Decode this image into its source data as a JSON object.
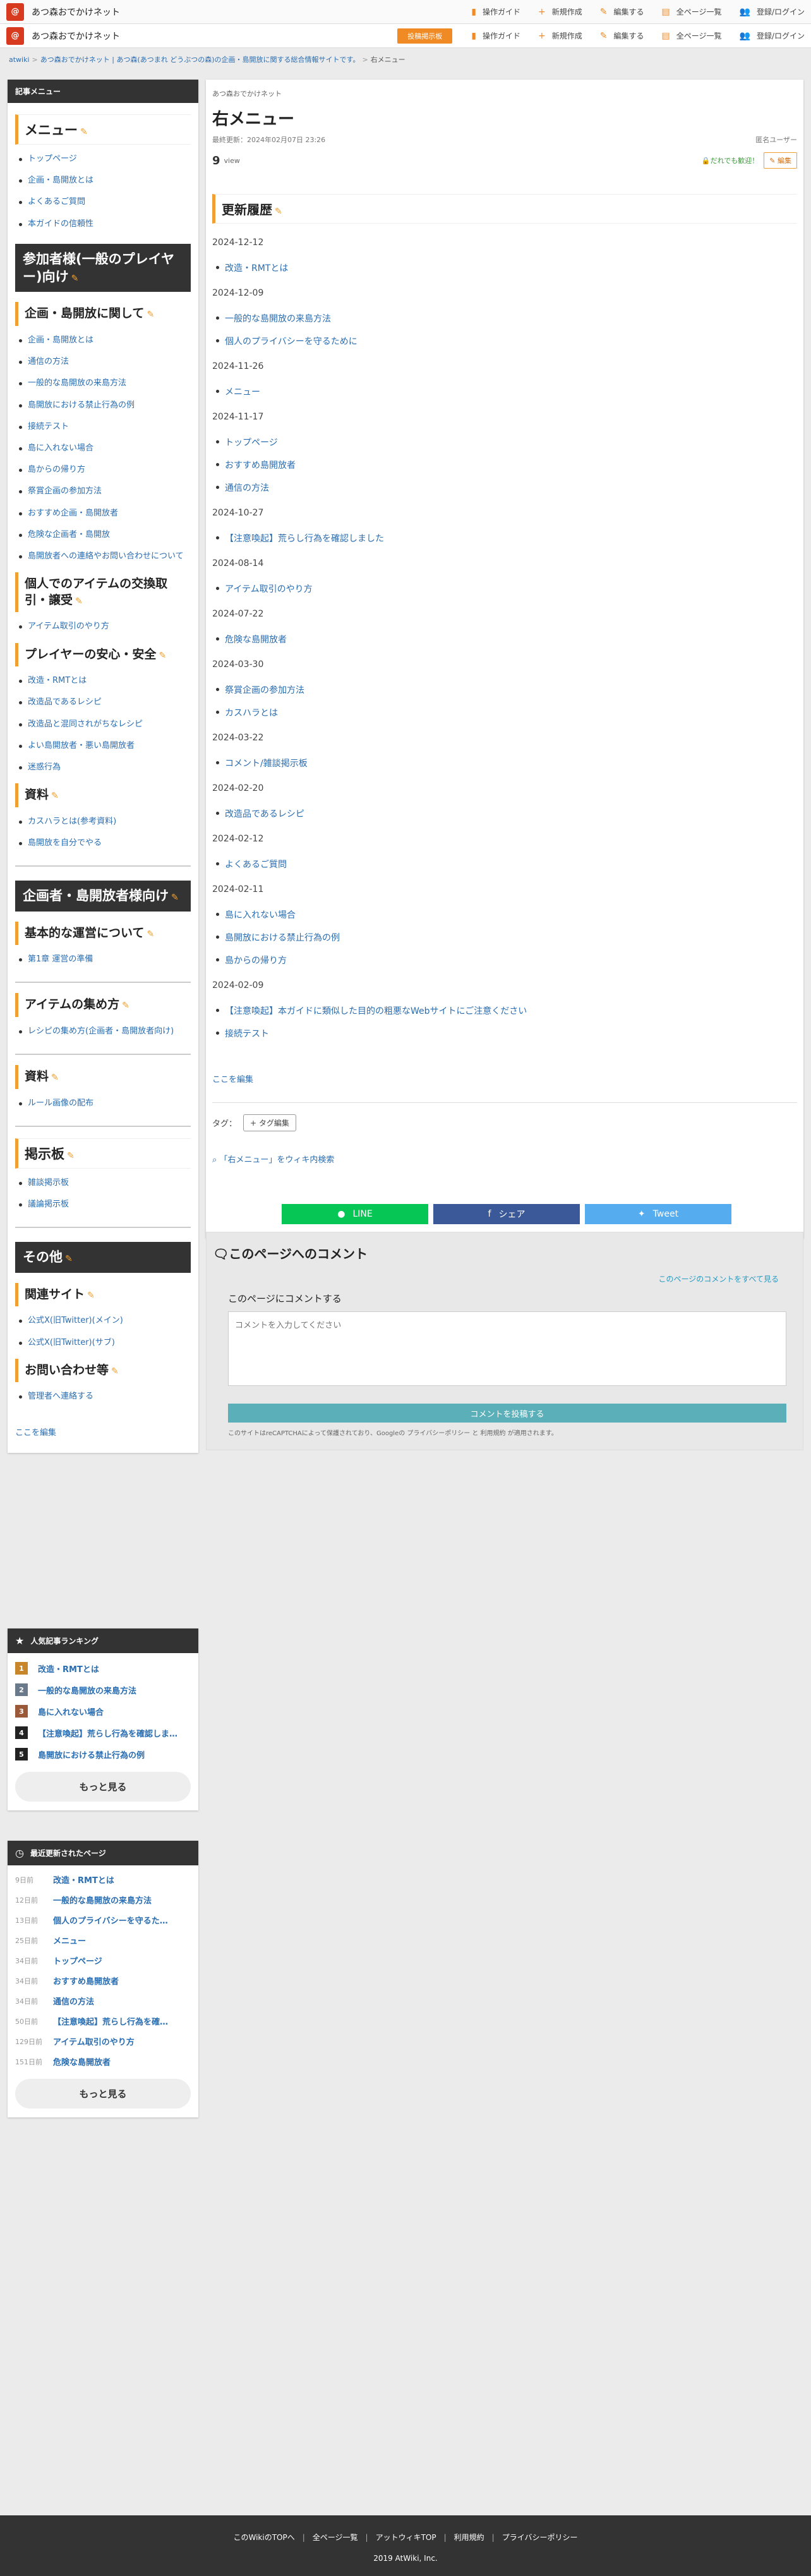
{
  "header": {
    "logo": "@",
    "site": "あつ森おでかけネット",
    "post_label": "投稿掲示板",
    "nav": [
      {
        "icon": "▮",
        "label": "操作ガイド"
      },
      {
        "icon": "+",
        "label": "新規作成"
      },
      {
        "icon": "✎",
        "label": "編集する"
      },
      {
        "icon": "▤",
        "label": "全ページ一覧"
      },
      {
        "icon": "👥",
        "label": "登録/ログイン"
      }
    ]
  },
  "breadcrumb": [
    "atwiki",
    "あつ森おでかけネット | あつ森(あつまれ どうぶつの森)の企画・島開放に関する総合情報サイトです。",
    "右メニュー"
  ],
  "sidebar": {
    "menu_header": "記事メニュー",
    "sections": [
      {
        "style": "h2o",
        "title": "メニュー",
        "items": [
          "トップページ",
          "企画・島開放とは",
          "よくあるご質問",
          "本ガイドの信頼性"
        ]
      },
      {
        "style": "h2d",
        "title": "参加者様(一般のプレイヤー)向け",
        "items": []
      },
      {
        "style": "h3o",
        "title": "企画・島開放に関して",
        "items": [
          "企画・島開放とは",
          "通信の方法",
          "一般的な島開放の来島方法",
          "島開放における禁止行為の例",
          "接続テスト",
          "島に入れない場合",
          "島からの帰り方",
          "祭賞企画の参加方法",
          "おすすめ企画・島開放者",
          "危険な企画者・島開放",
          "島開放者への連絡やお問い合わせについて"
        ]
      },
      {
        "style": "h3o",
        "title": "個人でのアイテムの交換取引・譲受",
        "items": [
          "アイテム取引のやり方"
        ]
      },
      {
        "style": "h3o",
        "title": "プレイヤーの安心・安全",
        "items": [
          "改造・RMTとは",
          "改造品であるレシピ",
          "改造品と混同されがちなレシピ",
          "よい島開放者・悪い島開放者",
          "迷惑行為"
        ]
      },
      {
        "style": "h3o",
        "title": "資料",
        "items": [
          "カスハラとは(参考資料)",
          "島開放を自分でやる"
        ]
      },
      {
        "style": "h2d",
        "title": "企画者・島開放者様向け",
        "items": [],
        "hr": true
      },
      {
        "style": "h3o",
        "title": "基本的な運営について",
        "items": [
          "第1章 運営の準備"
        ]
      },
      {
        "style": "h3o",
        "title": "アイテムの集め方",
        "items": [
          "レシピの集め方(企画者・島開放者向け)"
        ],
        "hr": true
      },
      {
        "style": "h3o",
        "title": "資料",
        "items": [
          "ルール画像の配布"
        ],
        "hr": true
      },
      {
        "style": "h2o",
        "title": "掲示板",
        "items": [
          "雑談掲示板",
          "議論掲示板"
        ],
        "hr": true
      },
      {
        "style": "h2d",
        "title": "その他",
        "items": [],
        "hr": true
      },
      {
        "style": "h3o",
        "title": "関連サイト",
        "items": [
          "公式X(旧Twitter)(メイン)",
          "公式X(旧Twitter)(サブ)"
        ]
      },
      {
        "style": "h3o",
        "title": "お問い合わせ等",
        "items": [
          "管理者へ連絡する"
        ]
      }
    ],
    "edit_link": "ここを編集",
    "ranking": {
      "title": "人気記事ランキング",
      "items": [
        {
          "n": "1",
          "t": "改造・RMTとは",
          "c": "#c8862a"
        },
        {
          "n": "2",
          "t": "一般的な島開放の来島方法",
          "c": "#6a7a8a"
        },
        {
          "n": "3",
          "t": "島に入れない場合",
          "c": "#9a5a3a"
        },
        {
          "n": "4",
          "t": "【注意喚起】荒らし行為を確認しま…",
          "c": "#222"
        },
        {
          "n": "5",
          "t": "島開放における禁止行為の例",
          "c": "#222"
        }
      ],
      "more": "もっと見る"
    },
    "recent": {
      "title": "最近更新されたページ",
      "items": [
        {
          "a": "9日前",
          "t": "改造・RMTとは"
        },
        {
          "a": "12日前",
          "t": "一般的な島開放の来島方法"
        },
        {
          "a": "13日前",
          "t": "個人のプライバシーを守るた…"
        },
        {
          "a": "25日前",
          "t": "メニュー"
        },
        {
          "a": "34日前",
          "t": "トップページ"
        },
        {
          "a": "34日前",
          "t": "おすすめ島開放者"
        },
        {
          "a": "34日前",
          "t": "通信の方法"
        },
        {
          "a": "50日前",
          "t": "【注意喚起】荒らし行為を確…"
        },
        {
          "a": "129日前",
          "t": "アイテム取引のやり方"
        },
        {
          "a": "151日前",
          "t": "危険な島開放者"
        }
      ],
      "more": "もっと見る"
    }
  },
  "main": {
    "site_small": "あつ森おでかけネット",
    "title": "右メニュー",
    "updated": "最終更新：2024年02月07日 23:26",
    "author": "匿名ユーザー",
    "views": "9",
    "views_unit": "view",
    "alert": "🔒だれでも歓迎！",
    "edit_btn": "✎ 編集",
    "section_title": "更新履歴",
    "history": [
      {
        "date": "2024-12-12",
        "items": [
          "改造・RMTとは"
        ]
      },
      {
        "date": "2024-12-09",
        "items": [
          "一般的な島開放の来島方法",
          "個人のプライバシーを守るために"
        ]
      },
      {
        "date": "2024-11-26",
        "items": [
          "メニュー"
        ]
      },
      {
        "date": "2024-11-17",
        "items": [
          "トップページ",
          "おすすめ島開放者",
          "通信の方法"
        ]
      },
      {
        "date": "2024-10-27",
        "items": [
          "【注意喚起】荒らし行為を確認しました"
        ]
      },
      {
        "date": "2024-08-14",
        "items": [
          "アイテム取引のやり方"
        ]
      },
      {
        "date": "2024-07-22",
        "items": [
          "危険な島開放者"
        ]
      },
      {
        "date": "2024-03-30",
        "items": [
          "祭賞企画の参加方法",
          "カスハラとは"
        ]
      },
      {
        "date": "2024-03-22",
        "items": [
          "コメント/雑談掲示板"
        ]
      },
      {
        "date": "2024-02-20",
        "items": [
          "改造品であるレシピ"
        ]
      },
      {
        "date": "2024-02-12",
        "items": [
          "よくあるご質問"
        ]
      },
      {
        "date": "2024-02-11",
        "items": [
          "島に入れない場合",
          "島開放における禁止行為の例",
          "島からの帰り方"
        ]
      },
      {
        "date": "2024-02-09",
        "items": [
          "【注意喚起】本ガイドに類似した目的の粗悪なWebサイトにご注意ください",
          "接続テスト"
        ]
      }
    ],
    "edit_link": "ここを編集",
    "tag_label": "タグ：",
    "tag_btn": "+ タグ編集",
    "search_link": "「右メニュー」をウィキ内検索",
    "share": [
      {
        "icon": "●",
        "label": "LINE",
        "color": "#06c755"
      },
      {
        "icon": "f",
        "label": "シェア",
        "color": "#3b5998"
      },
      {
        "icon": "✦",
        "label": "Tweet",
        "color": "#55acee"
      }
    ]
  },
  "comment": {
    "title": "このページへのコメント",
    "all": "このページのコメントをすべて見る",
    "label": "このページにコメントする",
    "placeholder": "コメントを入力してください",
    "submit": "コメントを投稿する",
    "recaptcha": "このサイトはreCAPTCHAによって保護されており、Googleの プライバシーポリシー と 利用規約 が適用されます。"
  },
  "footer": {
    "links": [
      "このWikiのTOPへ",
      "全ページ一覧",
      "アットウィキTOP",
      "利用規約",
      "プライバシーポリシー"
    ],
    "copy": "2019 AtWiki, Inc."
  }
}
